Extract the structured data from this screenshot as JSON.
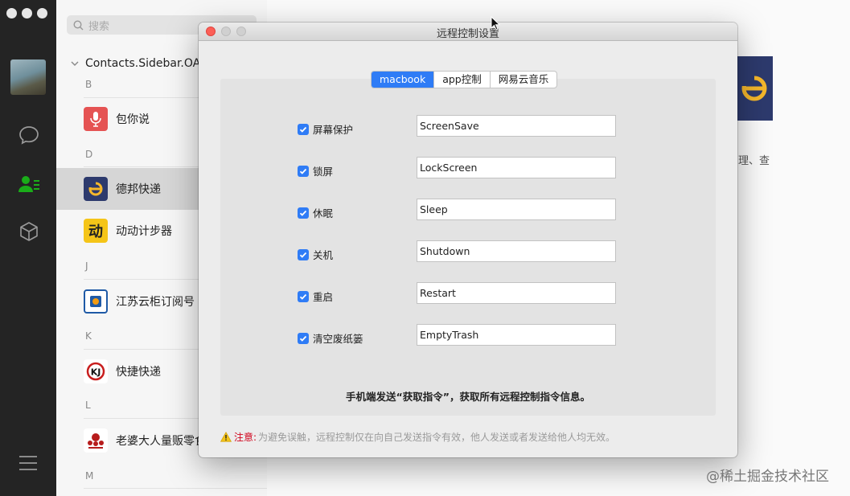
{
  "contacts_panel": {
    "search_placeholder": "搜索",
    "group_title": "Contacts.Sidebar.OAs",
    "sections": [
      {
        "letter": "B",
        "items": [
          {
            "name": "包你说",
            "icon": "microphone-icon",
            "color": "#e55353"
          }
        ]
      },
      {
        "letter": "D",
        "items": [
          {
            "name": "德邦快递",
            "icon": "debang-logo",
            "color": "#2d3a6d"
          },
          {
            "name": "动动计步器",
            "icon": "dongdong-logo",
            "color": "#f5c518"
          }
        ]
      },
      {
        "letter": "J",
        "items": [
          {
            "name": "江苏云柜订阅号",
            "icon": "jiangsu-cloud-logo",
            "color": "#1f5aa6"
          }
        ]
      },
      {
        "letter": "K",
        "items": [
          {
            "name": "快捷快递",
            "icon": "kuaijie-logo",
            "color": "#c81e1e"
          }
        ]
      },
      {
        "letter": "L",
        "items": [
          {
            "name": "老婆大人量贩零食",
            "icon": "laopo-logo",
            "color": "#b71c1c"
          }
        ]
      },
      {
        "letter": "M",
        "items": []
      }
    ]
  },
  "background": {
    "detail_text": "理、查"
  },
  "dialog": {
    "title": "远程控制设置",
    "tabs": [
      {
        "label": "macbook",
        "active": true
      },
      {
        "label": "app控制",
        "active": false
      },
      {
        "label": "网易云音乐",
        "active": false
      }
    ],
    "options": [
      {
        "label": "屏幕保护",
        "checked": true,
        "command": "ScreenSave"
      },
      {
        "label": "锁屏",
        "checked": true,
        "command": "LockScreen"
      },
      {
        "label": "休眠",
        "checked": true,
        "command": "Sleep"
      },
      {
        "label": "关机",
        "checked": true,
        "command": "Shutdown"
      },
      {
        "label": "重启",
        "checked": true,
        "command": "Restart"
      },
      {
        "label": "清空废纸篓",
        "checked": true,
        "command": "EmptyTrash"
      }
    ],
    "hint": "手机端发送“获取指令”，获取所有远程控制指令信息。",
    "notice_label": "注意:",
    "notice_text": "为避免误触，远程控制仅在向自己发送指令有效，他人发送或者发送给他人均无效。"
  },
  "watermark": "@稀土掘金技术社区",
  "colors": {
    "accent": "#2f7cf6",
    "warning": "#d0021b",
    "rail": "#242424"
  }
}
